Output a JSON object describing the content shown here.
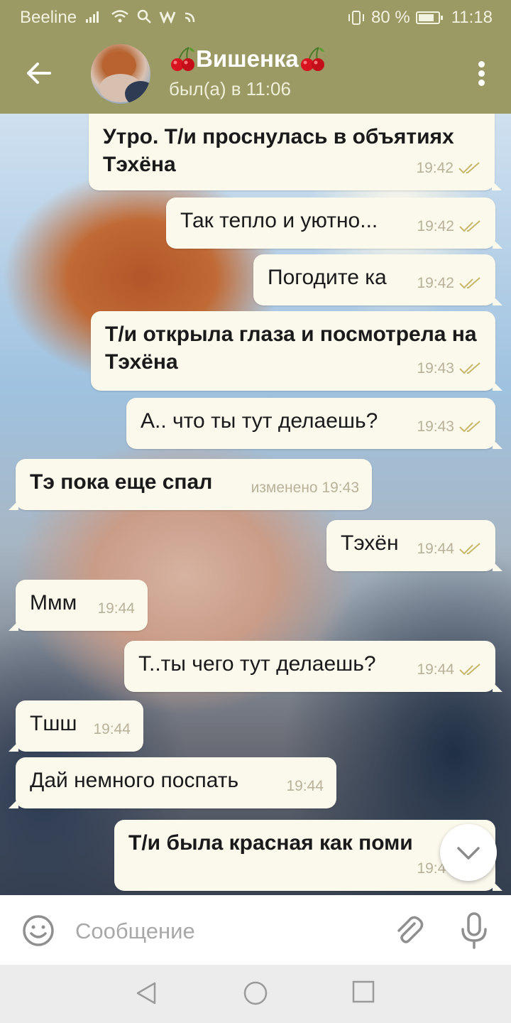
{
  "status_bar": {
    "carrier": "Beeline",
    "battery": "80 %",
    "battery_level": 0.8,
    "time": "11:18",
    "icons": [
      "signal-icon",
      "wifi-icon",
      "search-icon",
      "w-icon",
      "cast-icon",
      "vibrate-icon",
      "battery-icon"
    ]
  },
  "header": {
    "title": "Вишенка",
    "title_decoration": "cherry-icon",
    "status": "был(а) в 11:06",
    "color": "#9b9a65"
  },
  "messages": [
    {
      "direction": "out",
      "text": "Утро. Т/и проснулась в объятиях Тэхёна",
      "bold": true,
      "time": "19:42",
      "read": true
    },
    {
      "direction": "out",
      "text": "Так тепло и уютно...",
      "bold": false,
      "time": "19:42",
      "read": true
    },
    {
      "direction": "out",
      "text": "Погодите ка",
      "bold": false,
      "time": "19:42",
      "read": true
    },
    {
      "direction": "out",
      "text": "Т/и открыла глаза и посмотрела на Тэхёна",
      "bold": true,
      "time": "19:43",
      "read": true
    },
    {
      "direction": "out",
      "text": "А.. что ты тут делаешь?",
      "bold": false,
      "time": "19:43",
      "read": true
    },
    {
      "direction": "in",
      "text": "Тэ пока еще спал",
      "bold": true,
      "time": "изменено 19:43"
    },
    {
      "direction": "out",
      "text": "Тэхён",
      "bold": false,
      "time": "19:44",
      "read": true
    },
    {
      "direction": "in",
      "text": "Ммм",
      "bold": false,
      "time": "19:44"
    },
    {
      "direction": "out",
      "text": "Т..ты чего тут делаешь?",
      "bold": false,
      "time": "19:44",
      "read": true
    },
    {
      "direction": "in",
      "text": "Тшш",
      "bold": false,
      "time": "19:44"
    },
    {
      "direction": "in",
      "text": "Дай немного поспать",
      "bold": false,
      "time": "19:44"
    },
    {
      "direction": "out",
      "text": "Т/и была красная как поми",
      "bold": true,
      "time": "19:44",
      "read": true
    }
  ],
  "input": {
    "placeholder": "Сообщение"
  },
  "colors": {
    "bubble": "#fbf8ec",
    "read_check": "#c8b96a",
    "meta_text": "#b8b29a"
  }
}
